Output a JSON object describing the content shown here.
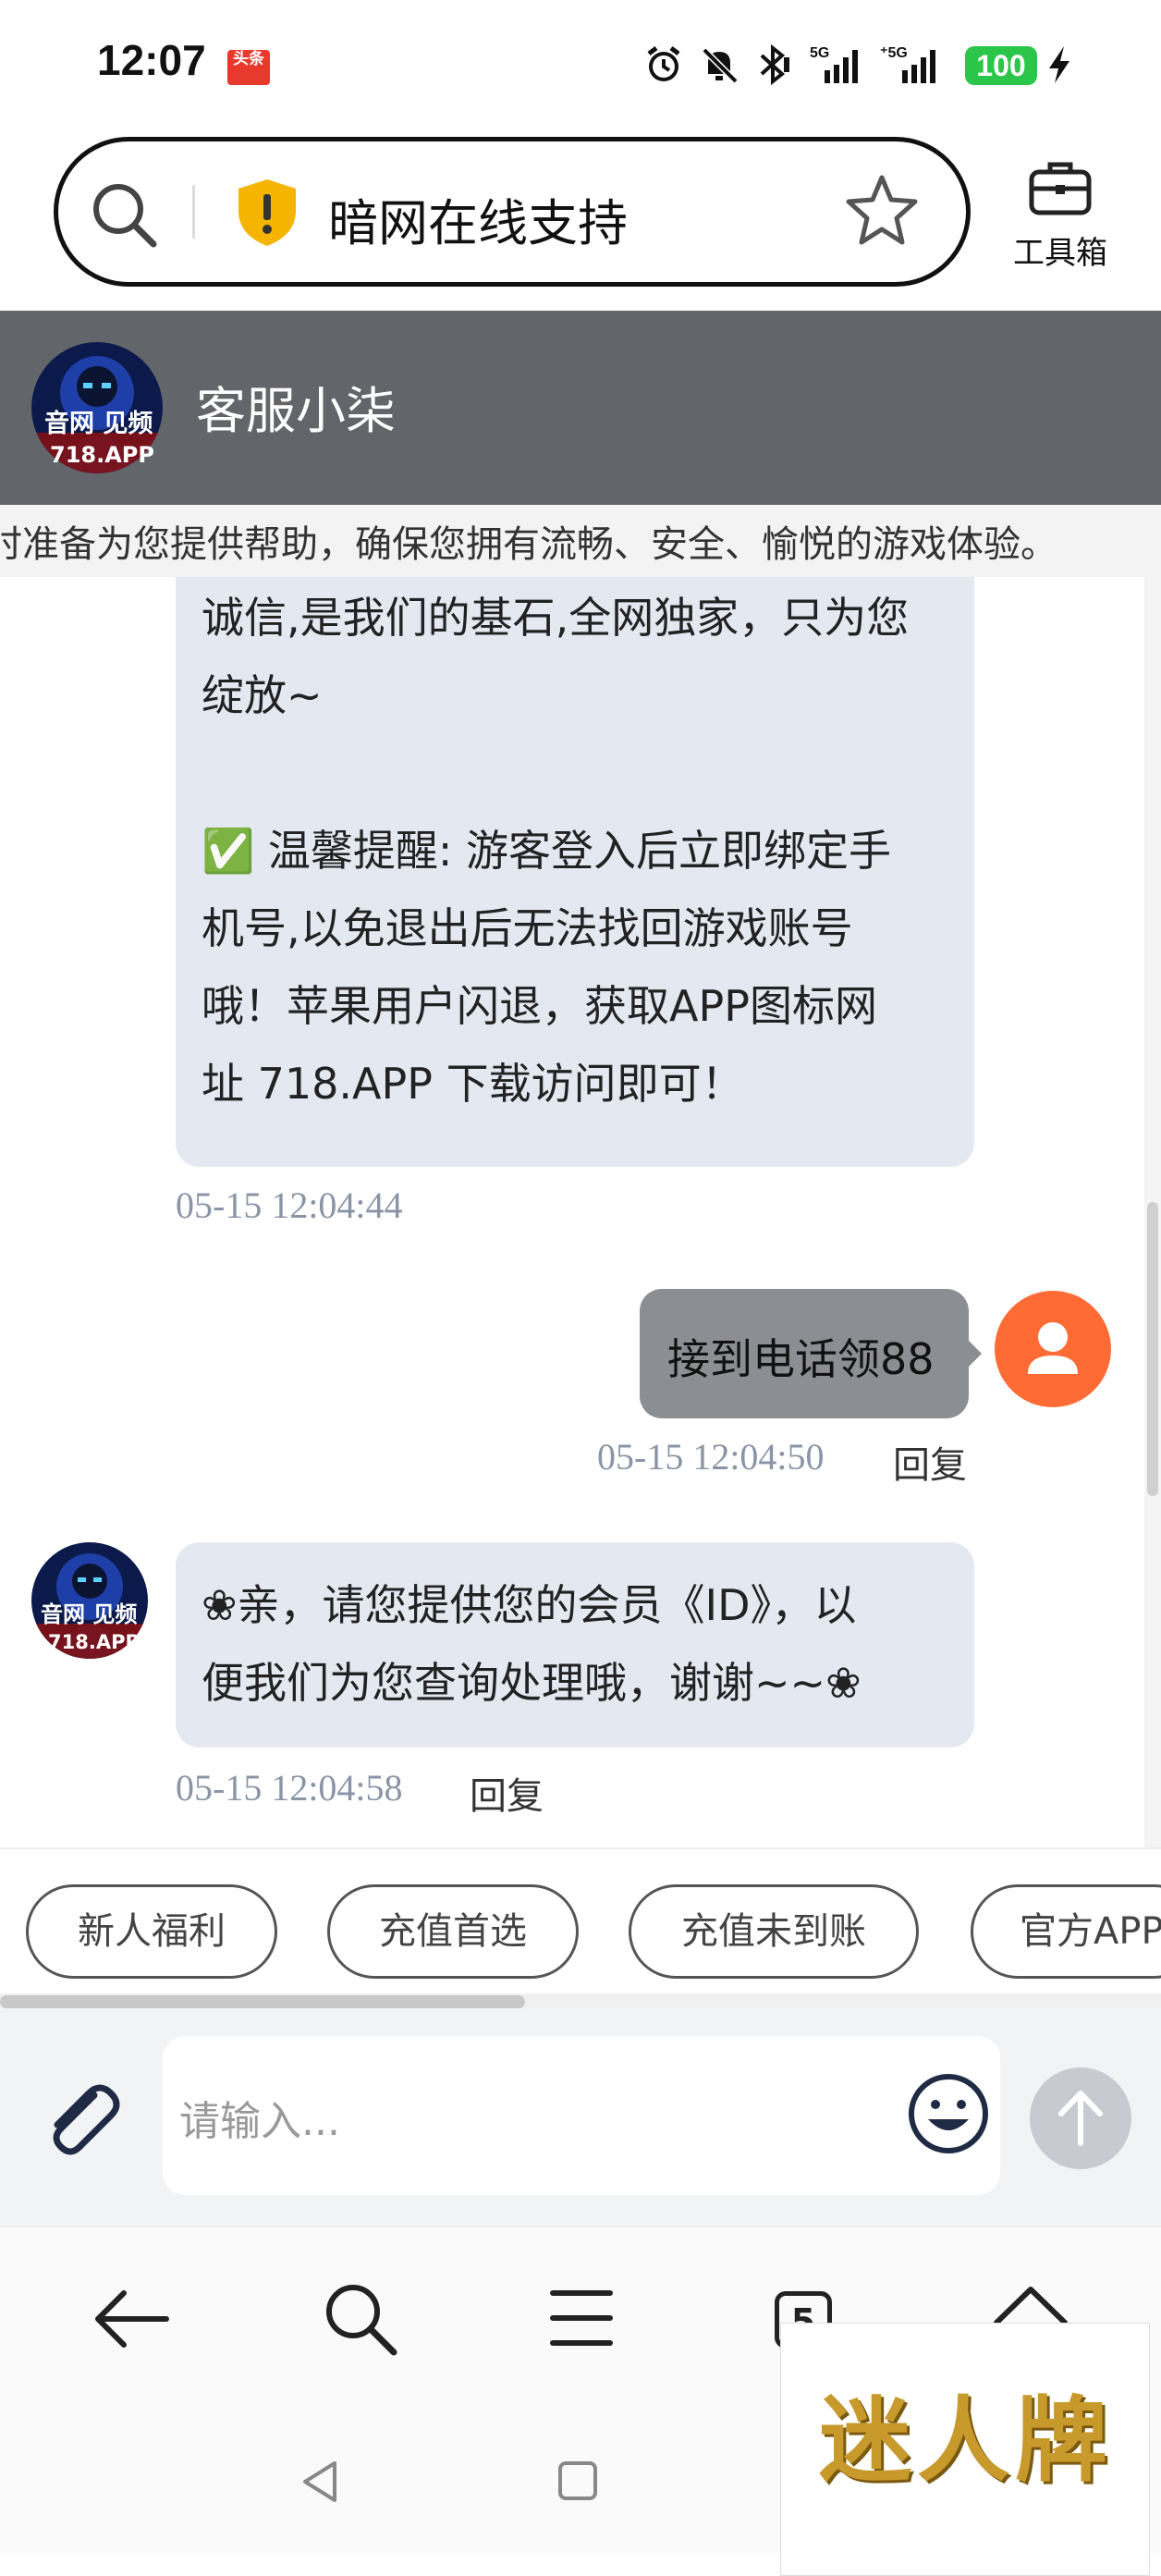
{
  "status_bar": {
    "time": "12:07",
    "app_badge": "头条",
    "battery": "100",
    "icons": [
      "alarm-icon",
      "mute-icon",
      "bluetooth-icon",
      "signal-5g-icon",
      "signal-5g-2-icon",
      "charging-icon"
    ]
  },
  "browser": {
    "address_text": "暗网在线支持",
    "toolbox_label": "工具箱",
    "tab_count": "5"
  },
  "chat": {
    "agent_name": "客服小柒",
    "avatar_text_line1": "音网 见频",
    "avatar_text_line2": "718.APP",
    "marquee": "时准备为您提供帮助，确保您拥有流畅、安全、愉悦的游戏体验。",
    "msg1": {
      "line1": "诚信,是我们的基石,全网独家，只为您",
      "line2": "绽放~",
      "line3": "✅ 温馨提醒: 游客登入后立即绑定手",
      "line4": "机号,以免退出后无法找回游戏账号",
      "line5": "哦！苹果用户闪退，获取APP图标网",
      "line6": "址 718.APP 下载访问即可！",
      "time": "05-15 12:04:44"
    },
    "msg2": {
      "text": "接到电话领88",
      "time": "05-15 12:04:50",
      "reply": "回复"
    },
    "msg3": {
      "line1": "❀亲，请您提供您的会员《ID》，以",
      "line2": "便我们为您查询处理哦，谢谢~~❀",
      "time": "05-15 12:04:58",
      "reply": "回复"
    },
    "chips": [
      "新人福利",
      "充值首选",
      "充值未到账",
      "官方APP"
    ],
    "input_placeholder": "请输入..."
  },
  "watermark": "迷人牌",
  "colors": {
    "header_bg": "#626569",
    "bubble_in": "#e3e8f1",
    "bubble_out": "#8b8e93",
    "user_avatar": "#ff6b35",
    "battery": "#2bc54a"
  }
}
